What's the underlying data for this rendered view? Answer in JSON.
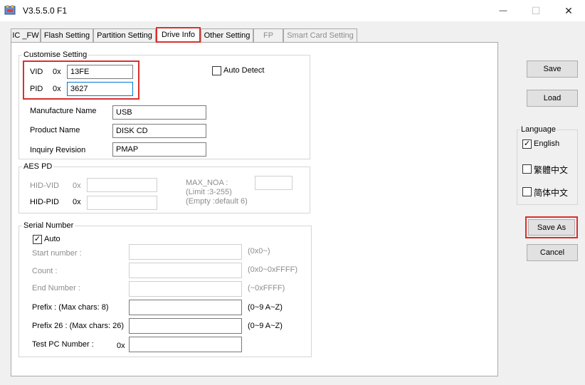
{
  "window": {
    "title": "V3.5.5.0 F1",
    "minimize_glyph": "—",
    "maximize_glyph": "☐",
    "close_glyph": "✕"
  },
  "tabs": [
    {
      "label": "IC _FW",
      "enabled": true
    },
    {
      "label": "Flash Setting",
      "enabled": true
    },
    {
      "label": "Partition Setting",
      "enabled": true
    },
    {
      "label": "Drive Info",
      "enabled": true,
      "active": true
    },
    {
      "label": "Other Setting",
      "enabled": true
    },
    {
      "label": "FP",
      "enabled": false
    },
    {
      "label": "Smart Card Setting",
      "enabled": false
    }
  ],
  "customise": {
    "legend": "Customise Setting",
    "vid_label": "VID",
    "vid_prefix": "0x",
    "vid_value": "13FE",
    "pid_label": "PID",
    "pid_prefix": "0x",
    "pid_value": "3627",
    "auto_detect_label": "Auto Detect",
    "auto_detect_checked": false,
    "manufacture_label": "Manufacture Name",
    "manufacture_value": "USB",
    "product_label": "Product Name",
    "product_value": "DISK CD",
    "inquiry_label": "Inquiry Revision",
    "inquiry_value": "PMAP"
  },
  "aes": {
    "legend": "AES PD",
    "hid_vid_label": "HID-VID",
    "hid_vid_prefix": "0x",
    "hid_vid_value": "",
    "hid_pid_label": "HID-PID",
    "hid_pid_prefix": "0x",
    "hid_pid_value": "",
    "max_noa_label": "MAX_NOA :",
    "max_noa_limit": "(Limit :3-255)",
    "max_noa_empty": "(Empty :default 6)",
    "max_noa_value": ""
  },
  "serial": {
    "legend": "Serial Number",
    "auto_label": "Auto",
    "auto_checked": true,
    "start_label": "Start number :",
    "start_hint": "(0x0~)",
    "count_label": "Count :",
    "count_hint": "(0x0~0xFFFF)",
    "end_label": "End Number :",
    "end_hint": "(~0xFFFF)",
    "prefix_label": "Prefix : (Max chars: 8)",
    "prefix_hint": "(0~9 A~Z)",
    "prefix26_label": "Prefix 26 : (Max chars: 26)",
    "prefix26_hint": "(0~9 A~Z)",
    "testpc_label": "Test PC Number :",
    "testpc_prefix": "0x"
  },
  "right_panel": {
    "save_label": "Save",
    "load_label": "Load",
    "language_legend": "Language",
    "languages": [
      {
        "label": "English",
        "checked": true
      },
      {
        "label": "繁體中文",
        "checked": false
      },
      {
        "label": "简体中文",
        "checked": false
      }
    ],
    "save_as_label": "Save As",
    "cancel_label": "Cancel"
  },
  "colors": {
    "highlight_red": "#d9302b",
    "focus_blue": "#0078d7"
  }
}
